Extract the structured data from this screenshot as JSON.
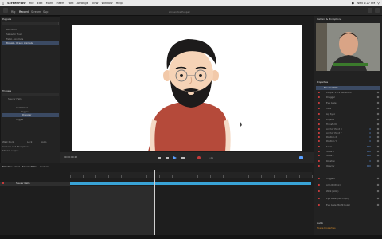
{
  "menubar": {
    "app_name": "ScreenFlow",
    "items": [
      "File",
      "Edit",
      "Mark",
      "Insert",
      "Font",
      "Arrange",
      "View",
      "Window",
      "Help"
    ],
    "clock": "Wed 4:27 PM"
  },
  "tabs": [
    "Rig",
    "Record",
    "Stream",
    "Sup"
  ],
  "active_tab": "Record",
  "window_title": "screenflowPuppet",
  "left_panel": {
    "header": "Puppets",
    "puppet_items": [
      "Luis Bold",
      "Salvador Nuer",
      "Fabio - Animals",
      "Bolsak - Ocean Animals"
    ],
    "triggers_header": "Triggers",
    "trigger_items": [
      "Saucer Hello",
      "Chat Hand",
      "Trigger",
      "Dragger",
      "Trigger"
    ],
    "controls_labels": [
      "Walk Mode",
      "Lock",
      "Auto"
    ],
    "camera_input": "Camera and Microphone",
    "stream_label": "Stream output"
  },
  "timeline": {
    "header": "Timeline: Scene - Saucer Hello",
    "tab2": "Controls",
    "track_name": "Saucer Hello",
    "time": "00:00:00:22",
    "zoom": "1.0x"
  },
  "right_panel": {
    "header": "Camera & Microphone",
    "properties_header": "Properties",
    "puppet_name": "Saucer Hello",
    "rows": [
      {
        "label": "Puppet Track Behaviors",
        "value": ""
      },
      {
        "label": "Dragger",
        "value": ""
      },
      {
        "label": "Eye Gaze",
        "value": ""
      },
      {
        "label": "Face",
        "value": ""
      },
      {
        "label": "Lip Sync",
        "value": ""
      },
      {
        "label": "Physics",
        "value": ""
      },
      {
        "label": "Transform",
        "value": ""
      },
      {
        "label": "Anchor Point X",
        "value": "0"
      },
      {
        "label": "Anchor Point Y",
        "value": "0"
      },
      {
        "label": "Position X",
        "value": "0"
      },
      {
        "label": "Position Y",
        "value": "0"
      },
      {
        "label": "Scale",
        "value": "100"
      },
      {
        "label": "Scale X",
        "value": "100"
      },
      {
        "label": "Scale Y",
        "value": "100"
      },
      {
        "label": "Rotation",
        "value": "0"
      },
      {
        "label": "Opacity",
        "value": "100"
      },
      {
        "label": "Triggers",
        "value": ""
      },
      {
        "label": "Arm R (Wink)",
        "value": ""
      },
      {
        "label": "Walk (Vote)",
        "value": ""
      },
      {
        "label": "Eye Gaze (Left Pupil)",
        "value": ""
      },
      {
        "label": "Eye Gaze (Right Pupil)",
        "value": ""
      }
    ],
    "footer_a": "Audio",
    "footer_b": "Scene Properties"
  },
  "colors": {
    "accent": "#5aa0ff",
    "track": "#39a3d6",
    "record": "#c23b3b",
    "shirt": "#b54a3a"
  }
}
